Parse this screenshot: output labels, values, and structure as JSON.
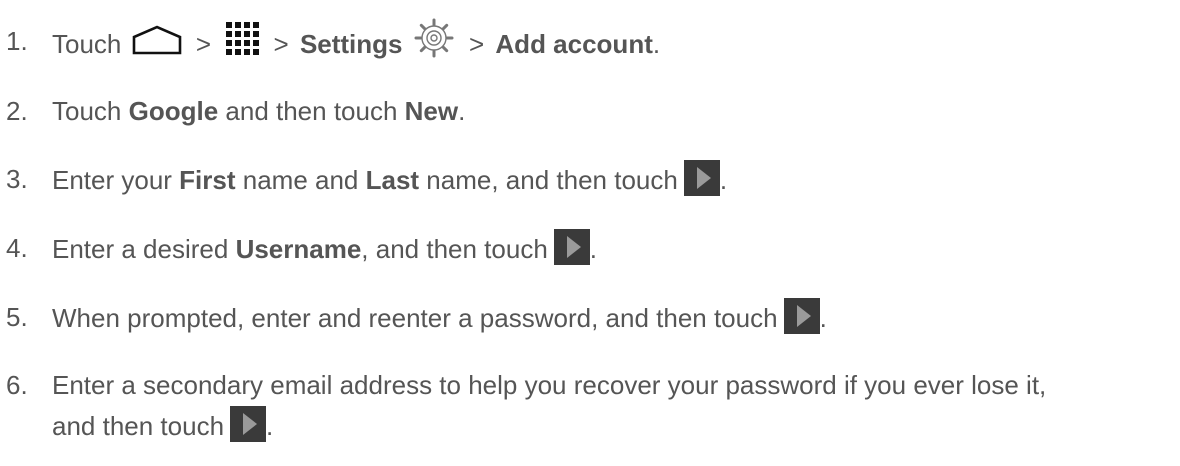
{
  "steps": [
    {
      "number": "1.",
      "prefix": "Touch",
      "sep1": ">",
      "sep2": ">",
      "settings": "Settings",
      "sep3": ">",
      "add_account": "Add account",
      "end": "."
    },
    {
      "number": "2.",
      "text_a": "Touch ",
      "bold_a": "Google",
      "text_b": " and then touch ",
      "bold_b": "New",
      "end": "."
    },
    {
      "number": "3.",
      "text_a": "Enter your ",
      "bold_a": "First",
      "text_b": " name and ",
      "bold_b": "Last",
      "text_c": " name, and then touch",
      "end": "."
    },
    {
      "number": "4.",
      "text_a": "Enter a desired ",
      "bold_a": "Username",
      "text_b": ", and then touch",
      "end": "."
    },
    {
      "number": "5.",
      "text_a": "When prompted, enter and reenter a password, and then touch",
      "end": "."
    },
    {
      "number": "6.",
      "text_a": "Enter a secondary email address to help you recover your password if you ever lose it,",
      "text_b": "and then touch",
      "end": "."
    }
  ],
  "icons": {
    "home": "home-icon",
    "apps": "apps-grid-icon",
    "settings": "settings-gear-icon",
    "next": "next-arrow-icon"
  }
}
